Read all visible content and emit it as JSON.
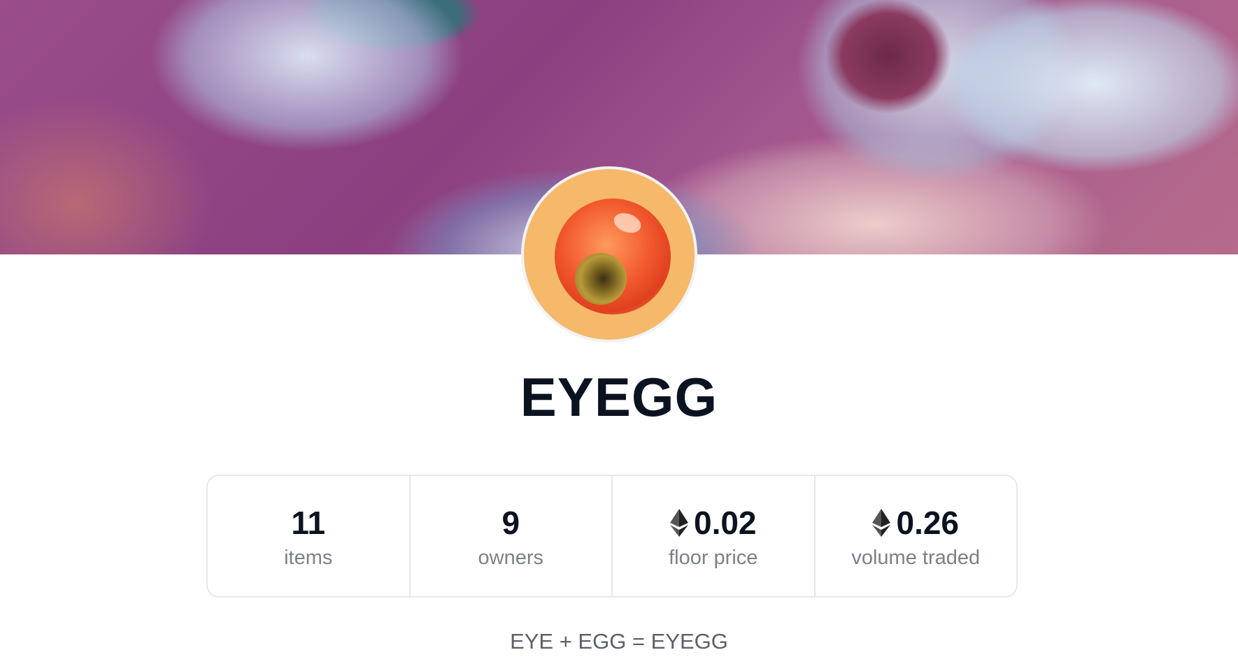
{
  "collection": {
    "title": "EYEGG",
    "description": "EYE + EGG = EYEGG"
  },
  "stats": [
    {
      "value": "11",
      "label": "items",
      "currency_icon": null
    },
    {
      "value": "9",
      "label": "owners",
      "currency_icon": null
    },
    {
      "value": "0.02",
      "label": "floor price",
      "currency_icon": "ethereum-icon"
    },
    {
      "value": "0.26",
      "label": "volume traded",
      "currency_icon": "ethereum-icon"
    }
  ],
  "colors": {
    "avatar_background": "#f6b96a",
    "text_primary": "#0b1220",
    "text_muted": "#7b8089",
    "border": "#e5e7eb"
  }
}
